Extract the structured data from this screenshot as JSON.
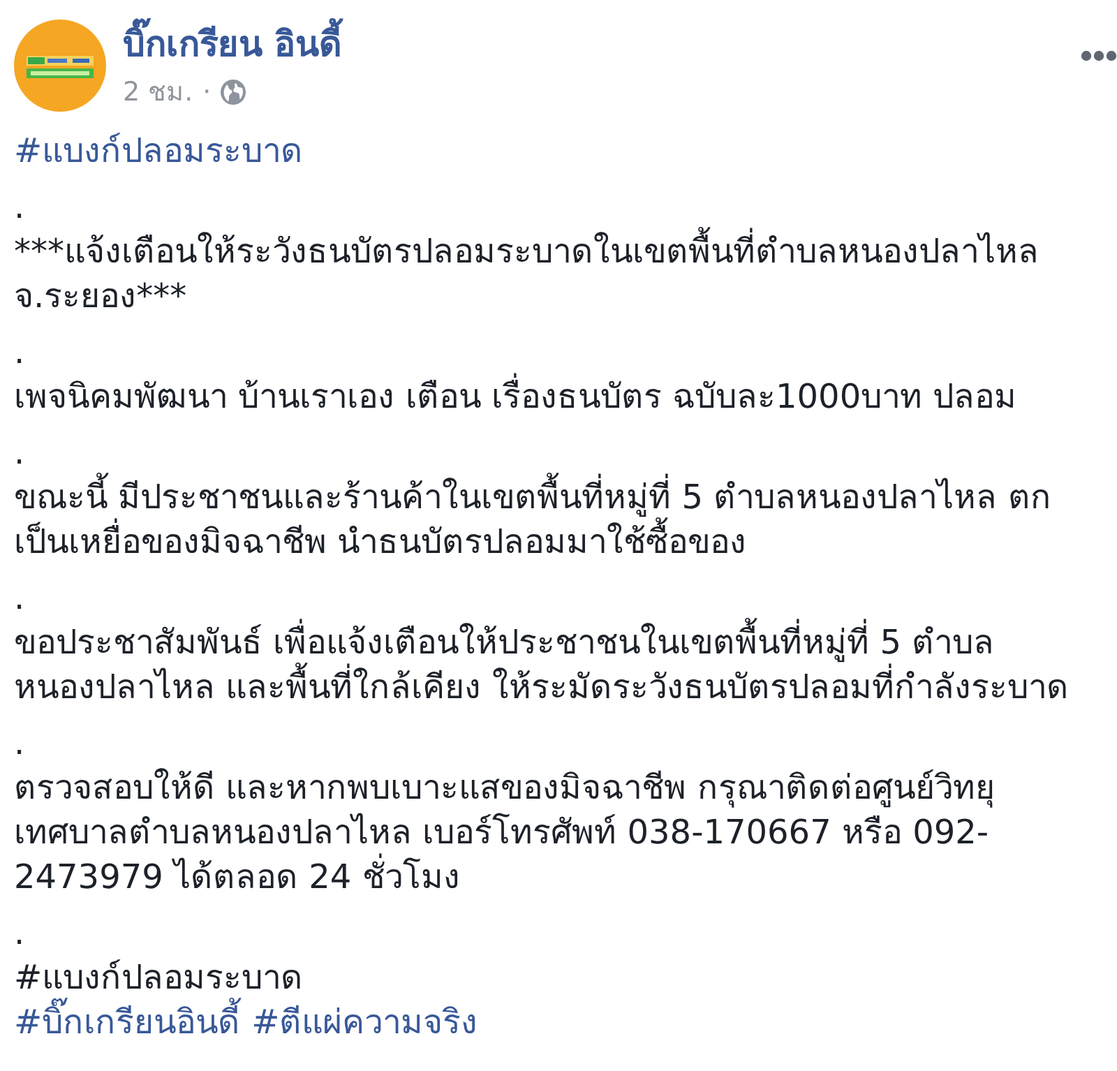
{
  "post": {
    "author": {
      "name": "บิ๊กเกรียน อินดี้"
    },
    "time": "2 ชม.",
    "separator": "·",
    "body": [
      {
        "kind": "hashtags",
        "tags": [
          "#แบงก์ปลอมระบาด"
        ]
      },
      {
        "kind": "text",
        "lines": [
          ".",
          "***แจ้งเตือนให้ระวังธนบัตรปลอมระบาดในเขตพื้นที่ตำบลหนองปลาไหล",
          "จ.ระยอง***"
        ]
      },
      {
        "kind": "text",
        "lines": [
          ".",
          "เพจนิคมพัฒนา บ้านเราเอง เตือน เรื่องธนบัตร ฉบับละ1000บาท ปลอม"
        ]
      },
      {
        "kind": "text",
        "lines": [
          ".",
          "ขณะนี้ มีประชาชนและร้านค้าในเขตพื้นที่หมู่ที่ 5 ตำบลหนองปลาไหล ตก",
          "เป็นเหยื่อของมิจฉาชีพ นำธนบัตรปลอมมาใช้ซื้อของ"
        ]
      },
      {
        "kind": "text",
        "lines": [
          ".",
          "ขอประชาสัมพันธ์ เพื่อแจ้งเตือนให้ประชาชนในเขตพื้นที่หมู่ที่ 5 ตำบล",
          "หนองปลาไหล และพื้นที่ใกล้เคียง ให้ระมัดระวังธนบัตรปลอมที่กำลังระบาด"
        ]
      },
      {
        "kind": "text",
        "lines": [
          ".",
          "ตรวจสอบให้ดี และหากพบเบาะแสของมิจฉาชีพ กรุณาติดต่อศูนย์วิทยุ",
          "เทศบาลตำบลหนองปลาไหล เบอร์โทรศัพท์ 038-170667 หรือ 092-",
          "2473979 ได้ตลอด 24 ชั่วโมง"
        ]
      },
      {
        "kind": "text",
        "lines": [
          ".",
          "#แบงก์ปลอมระบาด"
        ]
      },
      {
        "kind": "hashtags",
        "tags": [
          "#บิ๊กเกรียนอินดี้",
          "#ตีแผ่ความจริง"
        ]
      }
    ]
  }
}
